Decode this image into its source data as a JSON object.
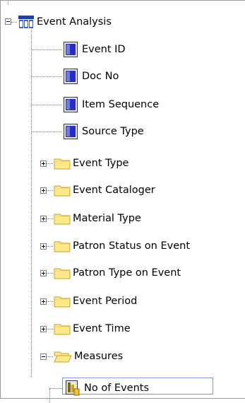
{
  "tree": {
    "root": {
      "label": "Event Analysis",
      "icon": "cube-table-icon",
      "expanded": true
    },
    "attributes": [
      {
        "label": "Event ID",
        "icon": "attribute-icon"
      },
      {
        "label": "Doc No",
        "icon": "attribute-icon"
      },
      {
        "label": "Item Sequence",
        "icon": "attribute-icon"
      },
      {
        "label": "Source Type",
        "icon": "attribute-icon"
      }
    ],
    "folders": [
      {
        "label": "Event Type",
        "icon": "folder-icon",
        "expanded": false
      },
      {
        "label": "Event Cataloger",
        "icon": "folder-icon",
        "expanded": false
      },
      {
        "label": "Material Type",
        "icon": "folder-icon",
        "expanded": false
      },
      {
        "label": "Patron Status on Event",
        "icon": "folder-icon",
        "expanded": false
      },
      {
        "label": "Patron Type on Event",
        "icon": "folder-icon",
        "expanded": false
      },
      {
        "label": "Event Period",
        "icon": "folder-icon",
        "expanded": false
      },
      {
        "label": "Event Time",
        "icon": "folder-icon",
        "expanded": false
      }
    ],
    "measures_folder": {
      "label": "Measures",
      "icon": "open-folder-icon",
      "expanded": true
    },
    "measure_items": [
      {
        "label": "No of Events",
        "icon": "measure-icon",
        "selected": true
      }
    ]
  },
  "colors": {
    "folder_fill": "#fde98a",
    "folder_edge": "#c9a227",
    "attribute_blue": "#2b2bcc",
    "measure_gold": "#d4a018",
    "selection_border": "#7b96d6"
  }
}
